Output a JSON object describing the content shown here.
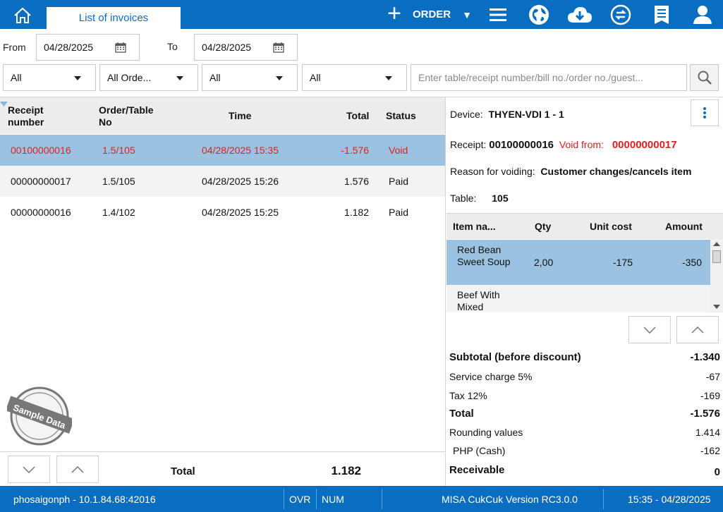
{
  "header": {
    "tab_label": "List of invoices",
    "order_label": "ORDER",
    "icons": [
      "home-icon",
      "plus-icon",
      "menu-icon",
      "globe-icon",
      "cloud-download-icon",
      "sync-icon",
      "report-icon",
      "user-icon"
    ]
  },
  "filters": {
    "from_label": "From",
    "from_date": "04/28/2025",
    "to_label": "To",
    "to_date": "04/28/2025",
    "select1": "All",
    "select2": "All Orde...",
    "select3": "All",
    "select4": "All",
    "search_placeholder": "Enter table/receipt number/bill no./order no./guest..."
  },
  "invoice_table": {
    "headers": {
      "receipt_line1": "Receipt",
      "receipt_line2": "number",
      "order_line1": "Order/Table",
      "order_line2": "No",
      "time": "Time",
      "total": "Total",
      "status": "Status"
    },
    "rows": [
      {
        "receipt": "00100000016",
        "order": "1.5/105",
        "time": "04/28/2025 15:35",
        "total": "-1.576",
        "status": "Void"
      },
      {
        "receipt": "00000000017",
        "order": "1.5/105",
        "time": "04/28/2025 15:26",
        "total": "1.576",
        "status": "Paid"
      },
      {
        "receipt": "00000000016",
        "order": "1.4/102",
        "time": "04/28/2025 15:25",
        "total": "1.182",
        "status": "Paid"
      }
    ],
    "footer_label": "Total",
    "footer_total": "1.182",
    "stamp_text": "Sample Data"
  },
  "detail": {
    "device_label": "Device:",
    "device_value": "THYEN-VDI 1 - 1",
    "receipt_label": "Receipt:",
    "receipt_value": "00100000016",
    "void_from_label": "Void from:",
    "void_from_value": "00000000017",
    "reason_label": "Reason for voiding:",
    "reason_value": "Customer changes/cancels item",
    "table_label": "Table:",
    "table_value": "105",
    "items_headers": {
      "name": "Item na...",
      "qty": "Qty",
      "unit_cost": "Unit cost",
      "amount": "Amount"
    },
    "items": [
      {
        "name": "Red Bean Sweet Soup",
        "qty": "2,00",
        "unit_cost": "-175",
        "amount": "-350"
      },
      {
        "name": "Beef With Mixed",
        "qty": "",
        "unit_cost": "",
        "amount": ""
      }
    ],
    "totals": [
      {
        "label": "Subtotal (before discount)",
        "value": "-1.340"
      },
      {
        "label": "Service charge 5%",
        "value": "-67"
      },
      {
        "label": "Tax 12%",
        "value": "-169"
      },
      {
        "label": "Total",
        "value": "-1.576"
      },
      {
        "label": "Rounding values",
        "value": "1.414"
      },
      {
        "label": "PHP (Cash)",
        "value": "-162"
      },
      {
        "label": "Receivable",
        "value": "0"
      }
    ]
  },
  "statusbar": {
    "server": "phosaigonph - 10.1.84.68:42016",
    "ovr": "OVR",
    "num": "NUM",
    "version": "MISA CukCuk Version RC3.0.0",
    "clock": "15:35 - 04/28/2025"
  },
  "colors": {
    "primary": "#0a6ec0",
    "selected_row": "#9bc3e1",
    "void_red": "#e02020"
  }
}
